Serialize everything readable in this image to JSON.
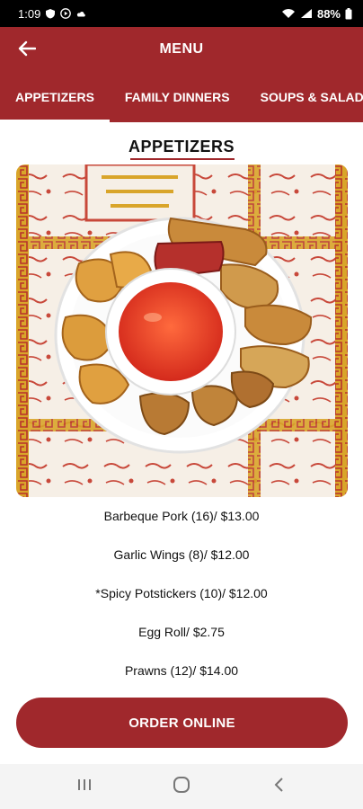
{
  "status_bar": {
    "time": "1:09",
    "battery": "88%",
    "icons": [
      "shield-icon",
      "play-icon",
      "cloud-icon",
      "wifi-icon",
      "signal-icon",
      "battery-icon"
    ]
  },
  "app_bar": {
    "back_icon": "arrow-left-icon",
    "title": "MENU",
    "tabs": [
      {
        "label": "APPETIZERS",
        "active": true
      },
      {
        "label": "FAMILY DINNERS",
        "active": false
      },
      {
        "label": "SOUPS & SALADS",
        "active": false
      }
    ]
  },
  "section": {
    "title": "APPETIZERS"
  },
  "menu_items": [
    "Barbeque Pork (16)/ $13.00",
    "Garlic Wings (8)/ $12.00",
    "*Spicy Potstickers (10)/ $12.00",
    "Egg Roll/ $2.75",
    "Prawns (12)/ $14.00"
  ],
  "order_button": {
    "label": "ORDER ONLINE"
  },
  "nav_bar": {
    "icons": [
      "recent-apps-icon",
      "home-icon",
      "back-icon"
    ]
  },
  "colors": {
    "brand": "#a0282c",
    "background": "#ffffff"
  }
}
